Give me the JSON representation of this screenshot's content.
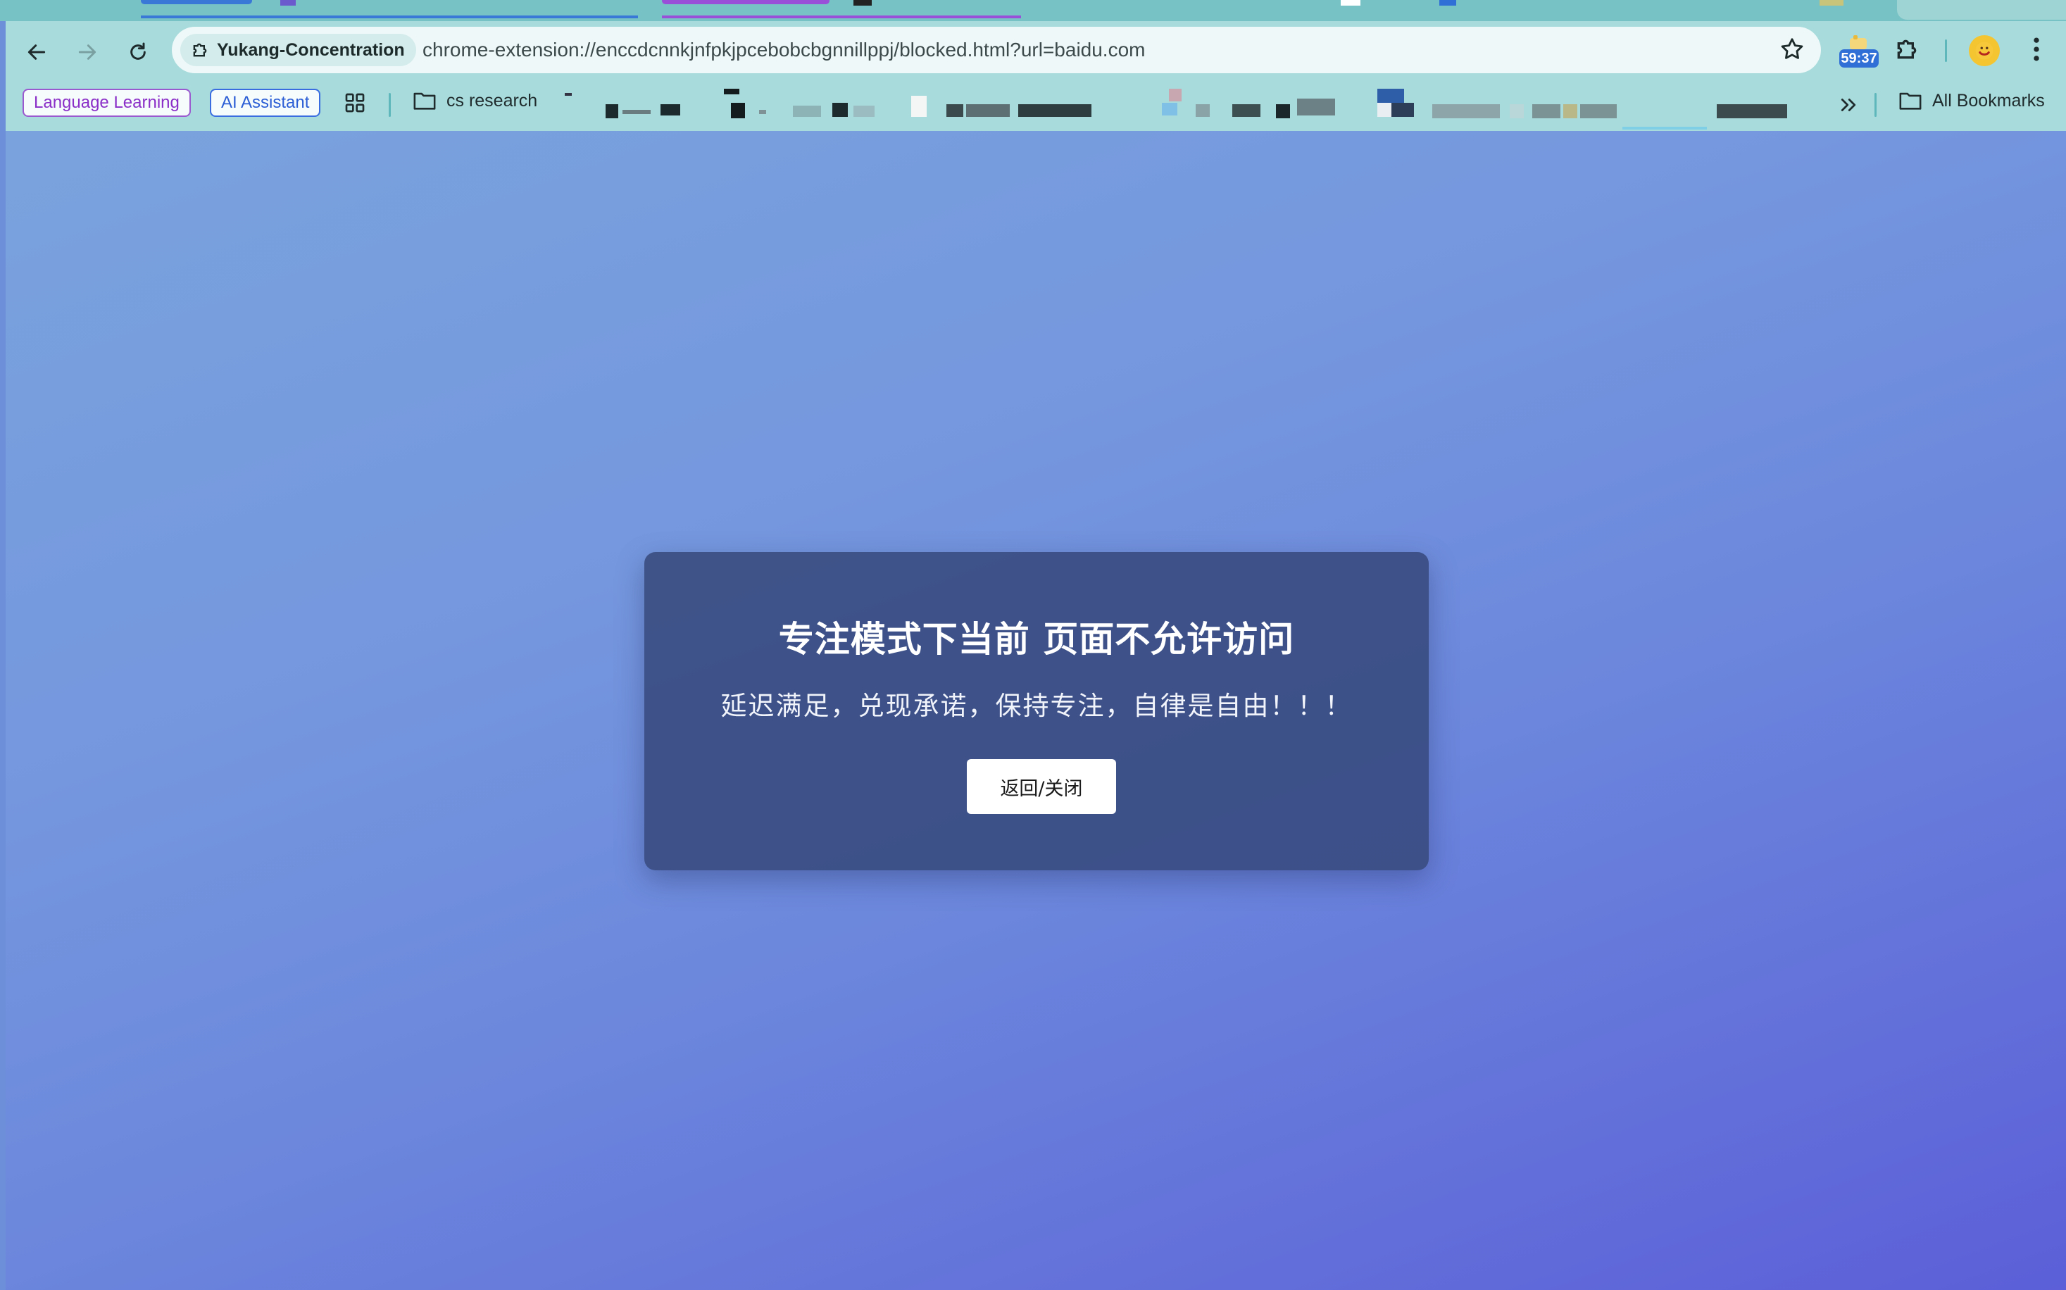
{
  "browser": {
    "site_chip_label": "Yukang-Concentration",
    "url": "chrome-extension://enccdcnnkjnfpkjpcebobcbgnnillppj/blocked.html?url=baidu.com",
    "extension_timer": "59:37"
  },
  "bookmarks": {
    "items": [
      {
        "label": "Language Learning",
        "color": "#8a2fc7"
      },
      {
        "label": "AI Assistant",
        "color": "#2c5fd6"
      }
    ],
    "folder_label": "cs research",
    "all_bookmarks_label": "All Bookmarks"
  },
  "blocked_page": {
    "title": "专注模式下当前 页面不允许访问",
    "subtitle": "延迟满足，兑现承诺，保持专注，自律是自由！！！",
    "button_label": "返回/关闭"
  },
  "colors": {
    "chrome_bg": "#a8dcdc",
    "gradient_start": "#7aa3dd",
    "gradient_end": "#5c5fd8",
    "card_bg": "#344678"
  }
}
